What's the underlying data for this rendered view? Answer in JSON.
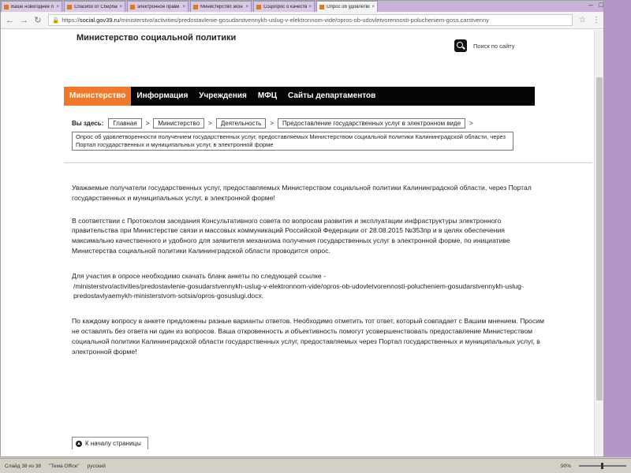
{
  "tabs": [
    {
      "label": "Ваше новогоднее п",
      "active": false
    },
    {
      "label": "Спасибо от Сбербан",
      "active": false
    },
    {
      "label": "электронное прави",
      "active": false
    },
    {
      "label": "Министерство экон",
      "active": false
    },
    {
      "label": "Соцопрос о качеств",
      "active": false
    },
    {
      "label": "Опрос об удовлетвор",
      "active": true
    }
  ],
  "address": {
    "scheme": "https://",
    "host": "social.gov39.ru",
    "path": "/ministerstvo/activities/predostavlenie-gosudarstvennykh-uslug-v-elektronnom-vide/opros-ob-udovletvorennosti-polucheniem-goss.carstvenny"
  },
  "site": {
    "title": "Министерство социальной политики",
    "search_label": "Поиск по сайту"
  },
  "nav": {
    "items": [
      "Министерство",
      "Информация",
      "Учреждения",
      "МФЦ",
      "Сайты департаментов"
    ],
    "active_index": 0
  },
  "breadcrumbs": {
    "prefix": "Вы здесь:",
    "items": [
      "Главная",
      "Министерство",
      "Деятельность",
      "Предоставление государственных услуг в электронном виде"
    ],
    "separator": ">",
    "current": "Опрос об удовлетворенности получением государственных услуг, предоставляемых Министерством социальной политики Калининградской области, через Портал государственных и муниципальных услуг, в электронной форме"
  },
  "content": {
    "p1": "Уважаемые получатели государственных услуг, предоставляемых Министерством социальной политики Калининградской области, через Портал государственных и муниципальных услуг, в электронной форме!",
    "p2": "В соответствии с Протоколом заседания Консультативного совета по вопросам развития и эксплуатации инфраструктуры электронного правительства при Министерстве связи и массовых коммуникаций Российской Федерации от 28.08.2015 №353пр и в целях обеспечения максимально качественного и удобного для заявителя механизма получения государственных услуг в электронной форме, по инициативе Министерства социальной политики Калининградской области проводится опрос.",
    "p3_text": "Для участия в опросе необходимо скачать бланк анкеты по следующей ссылке -",
    "p3_path": "/ministerstvo/activities/predostavlenie-gosudarstvennykh-uslug-v-elektronnom-vide/opros-ob-udovletvorennosti-polucheniem-gosudarstvennykh-uslug-predostavlyaemykh-ministerstvom-sotsia/opros-gosuslugi.docx.",
    "p4": "По каждому вопросу в анкете предложены разные варианты ответов. Необходимо отметить тот ответ, который совпадает с Вашим мнением. Просим не оставлять без ответа ни один из вопросов. Ваша откровенность и объективность помогут усовершенствовать предоставление Министерством социальной политики Калининградской области государственных услуг, предоставляемых через Портал государственных и муниципальных услуг, в электронной форме!",
    "to_top": "К началу страницы"
  },
  "statusbar": {
    "slide": "Слайд 38 из 38",
    "theme": "\"Тема Office\"",
    "lang": "русский",
    "zoom": "90%"
  }
}
